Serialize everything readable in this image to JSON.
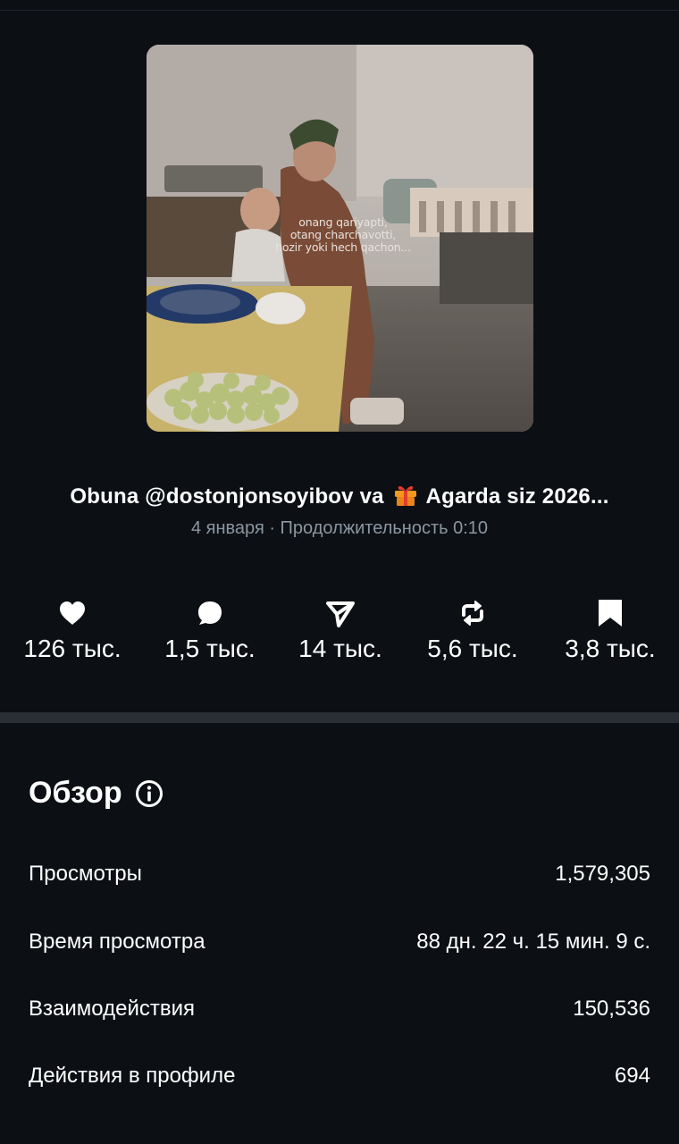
{
  "post": {
    "thumbnail_caption": [
      "onang qariyapti,",
      "otang charchavotti,",
      "hozir yoki hech qachon..."
    ],
    "title_before": "Obuna @dostonjonsoyibov va",
    "title_icon": "gift-icon",
    "title_after": "Agarda siz 2026...",
    "meta": "4 января · Продолжительность 0:10"
  },
  "stats": [
    {
      "icon": "heart-icon",
      "value": "126 тыс."
    },
    {
      "icon": "comment-icon",
      "value": "1,5 тыс."
    },
    {
      "icon": "share-icon",
      "value": "14 тыс."
    },
    {
      "icon": "repost-icon",
      "value": "5,6 тыс."
    },
    {
      "icon": "bookmark-icon",
      "value": "3,8 тыс."
    }
  ],
  "overview": {
    "heading": "Обзор",
    "info_icon": "info-icon",
    "rows": [
      {
        "label": "Просмотры",
        "value": "1,579,305"
      },
      {
        "label": "Время просмотра",
        "value": "88 дн. 22 ч. 15 мин. 9 с."
      },
      {
        "label": "Взаимодействия",
        "value": "150,536"
      },
      {
        "label": "Действия в профиле",
        "value": "694"
      }
    ]
  },
  "colors": {
    "background": "#0c1015",
    "muted_text": "#8b96a0",
    "divider": "#2a2f35"
  }
}
